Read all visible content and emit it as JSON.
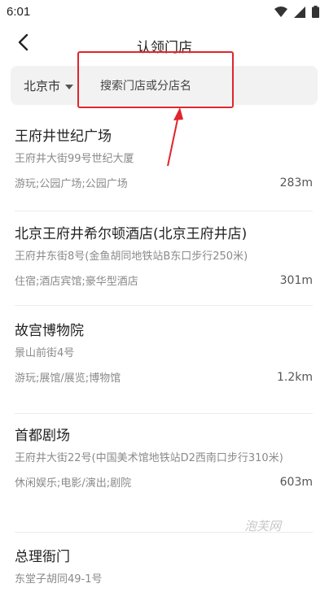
{
  "status_bar": {
    "time": "6:01",
    "icons": [
      "wifi-icon",
      "signal-icon",
      "battery-icon"
    ]
  },
  "nav": {
    "back_icon": "chevron-left-icon",
    "title": "认领门店"
  },
  "search": {
    "city": "北京市",
    "city_dropdown_icon": "caret-down-icon",
    "placeholder": "搜索门店或分店名"
  },
  "annotation": {
    "color": "#e0252c"
  },
  "stores": [
    {
      "name": "王府井世纪广场",
      "address": "王府井大街99号世纪大厦",
      "category": "游玩;公园广场;公园广场",
      "distance": "283m"
    },
    {
      "name": "北京王府井希尔顿酒店(北京王府井店)",
      "address": "王府井东街8号(金鱼胡同地铁站B东口步行250米)",
      "category": "住宿;酒店宾馆;豪华型酒店",
      "distance": "301m"
    },
    {
      "name": "故宫博物院",
      "address": "景山前街4号",
      "category": "游玩;展馆/展览;博物馆",
      "distance": "1.2km"
    },
    {
      "name": "首都剧场",
      "address": "王府井大街22号(中国美术馆地铁站D2西南口步行310米)",
      "category": "休闲娱乐;电影/演出;剧院",
      "distance": "603m"
    },
    {
      "name": "总理衙门",
      "address": "东堂子胡同49-1号",
      "category": "",
      "distance": ""
    }
  ],
  "watermark": "泡芙网"
}
